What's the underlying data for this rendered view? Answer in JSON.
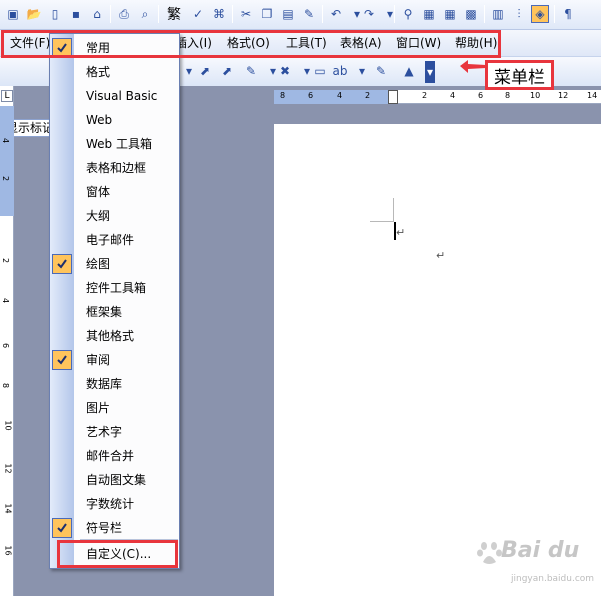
{
  "menubar": {
    "items": [
      "文件(F)",
      "插入(I)",
      "格式(O)",
      "工具(T)",
      "表格(A)",
      "窗口(W)",
      "帮助(H)"
    ]
  },
  "toolbar": {
    "traditional_glyph": "繁",
    "style_combo_value": "显示标记"
  },
  "callout": {
    "text": "菜单栏"
  },
  "dropdown": {
    "items": [
      {
        "label": "常用",
        "checked": true
      },
      {
        "label": "格式",
        "checked": false
      },
      {
        "label": "Visual Basic",
        "checked": false
      },
      {
        "label": "Web",
        "checked": false
      },
      {
        "label": "Web 工具箱",
        "checked": false
      },
      {
        "label": "表格和边框",
        "checked": false
      },
      {
        "label": "窗体",
        "checked": false
      },
      {
        "label": "大纲",
        "checked": false
      },
      {
        "label": "电子邮件",
        "checked": false
      },
      {
        "label": "绘图",
        "checked": true
      },
      {
        "label": "控件工具箱",
        "checked": false
      },
      {
        "label": "框架集",
        "checked": false
      },
      {
        "label": "其他格式",
        "checked": false
      },
      {
        "label": "审阅",
        "checked": true
      },
      {
        "label": "数据库",
        "checked": false
      },
      {
        "label": "图片",
        "checked": false
      },
      {
        "label": "艺术字",
        "checked": false
      },
      {
        "label": "邮件合并",
        "checked": false
      },
      {
        "label": "自动图文集",
        "checked": false
      },
      {
        "label": "字数统计",
        "checked": false
      },
      {
        "label": "符号栏",
        "checked": true
      },
      {
        "label": "自定义(C)...",
        "checked": false
      }
    ]
  },
  "top_ruler": {
    "ticks": [
      "8",
      "6",
      "4",
      "2",
      "2",
      "4",
      "6",
      "8",
      "10",
      "12",
      "14"
    ]
  },
  "left_ruler": {
    "ticks": [
      "4",
      "2",
      "2",
      "4",
      "6",
      "8",
      "10",
      "12",
      "14",
      "16"
    ]
  },
  "ruler_corner": "L",
  "paragraph_mark": "↵",
  "watermark": {
    "brand": "Bai du",
    "site": "jingyan.baidu.com"
  },
  "colors": {
    "highlight": "#e8353d",
    "check_bg": "#ffc45c",
    "toolbar": "#dfe8f8"
  }
}
